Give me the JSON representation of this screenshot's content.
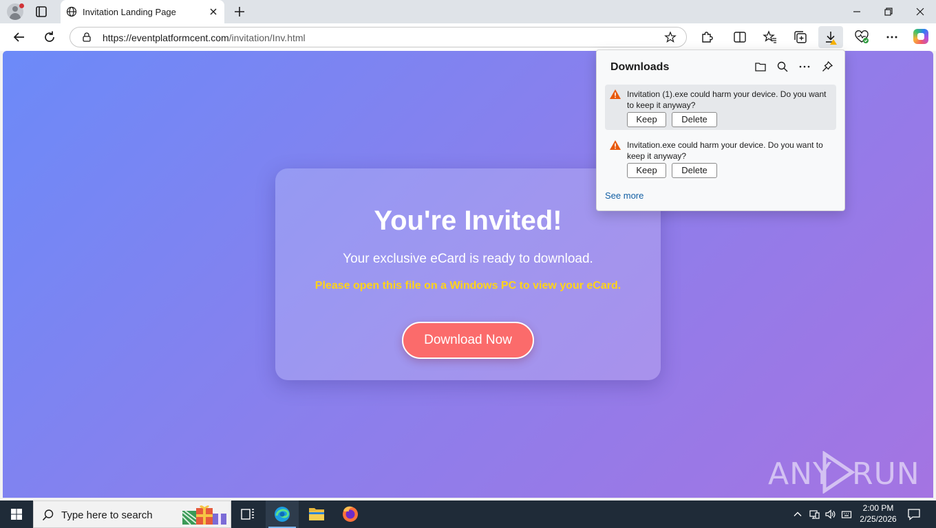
{
  "browser": {
    "tab_title": "Invitation Landing Page",
    "url_host": "https://eventplatformcent.com",
    "url_path": "/invitation/Inv.html"
  },
  "page": {
    "heading": "You're Invited!",
    "subtitle": "Your exclusive eCard is ready to download.",
    "notice": "Please open this file on a Windows PC to view your eCard.",
    "download_button": "Download Now",
    "watermark_left": "ANY",
    "watermark_right": "RUN"
  },
  "downloads": {
    "title": "Downloads",
    "items": [
      {
        "message": "Invitation (1).exe could harm your device. Do you want to keep it anyway?",
        "keep": "Keep",
        "delete": "Delete",
        "selected": true
      },
      {
        "message": "Invitation.exe could harm your device. Do you want to keep it anyway?",
        "keep": "Keep",
        "delete": "Delete",
        "selected": false
      }
    ],
    "see_more": "See more"
  },
  "taskbar": {
    "search_placeholder": "Type here to search",
    "time": "2:00 PM",
    "date": "2/25/2026"
  },
  "colors": {
    "accent_button": "#fb6b6b",
    "notice_text": "#ffd31a",
    "warning_icon": "#e8590c",
    "link": "#115ea3"
  },
  "icons": [
    "profile-icon",
    "tab-actions-icon",
    "globe-icon",
    "close-icon",
    "new-tab-icon",
    "minimize-icon",
    "restore-icon",
    "back-icon",
    "refresh-icon",
    "lock-icon",
    "favorite-star-icon",
    "extensions-icon",
    "split-screen-icon",
    "favorites-icon",
    "collections-icon",
    "downloads-icon",
    "browser-essentials-icon",
    "more-icon",
    "copilot-icon",
    "folder-icon",
    "search-icon",
    "pin-icon",
    "warning-icon",
    "windows-start-icon",
    "task-view-icon",
    "edge-icon",
    "file-explorer-icon",
    "firefox-icon",
    "chevron-up-icon",
    "network-icon",
    "volume-icon",
    "keyboard-icon",
    "notifications-icon"
  ]
}
